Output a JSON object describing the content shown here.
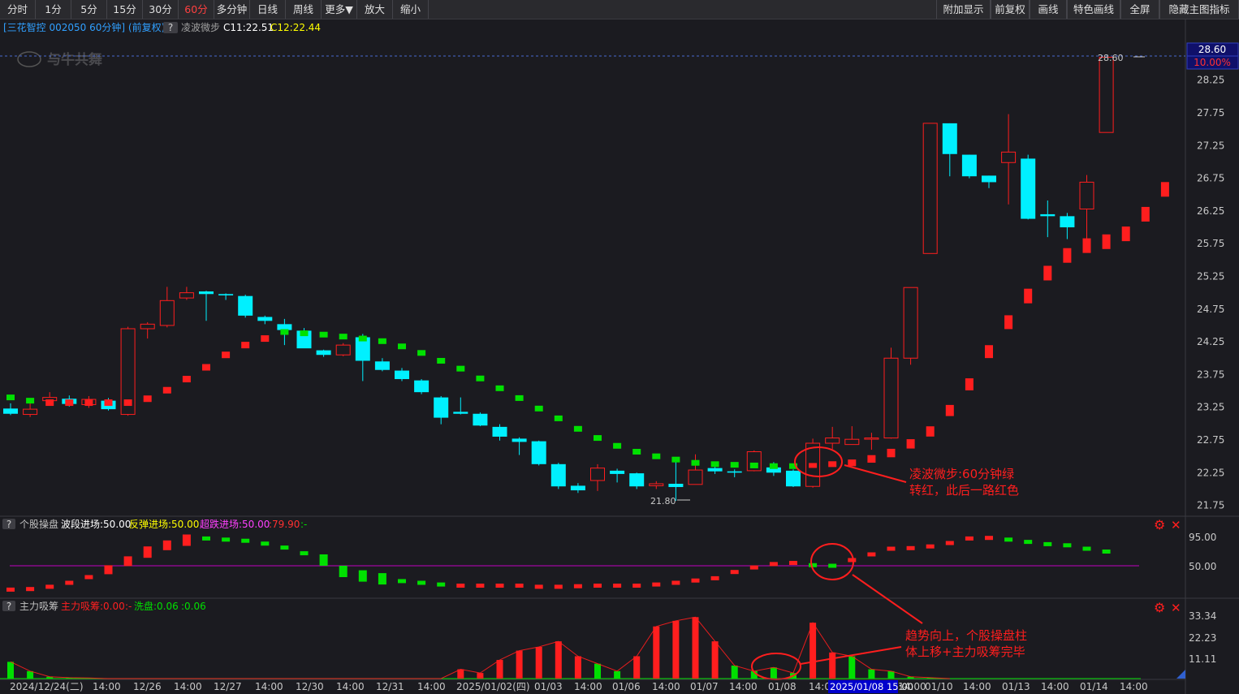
{
  "toolbar": {
    "left": [
      "分时",
      "1分",
      "5分",
      "15分",
      "30分",
      "60分",
      "多分钟",
      "日线",
      "周线",
      "更多▼",
      "放大",
      "缩小"
    ],
    "active": "60分",
    "right": [
      "附加显示",
      "前复权",
      "画线",
      "特色画线",
      "全屏",
      "隐藏主图指标"
    ]
  },
  "header": {
    "stock": "[三花智控 002050 60分钟] (前复权)",
    "q": "?",
    "indicator": "凌波微步",
    "c1": "C11:22.51",
    "c2": "C12:22.44"
  },
  "watermark": "与牛共舞",
  "price_axis": {
    "labels": [
      "28.25",
      "27.75",
      "27.25",
      "26.75",
      "26.25",
      "25.75",
      "25.25",
      "24.75",
      "24.25",
      "23.75",
      "23.25",
      "22.75",
      "22.25",
      "21.75"
    ],
    "high_price": "28.60",
    "high_pct": "10.00%",
    "high_label": "28.60",
    "low_label": "21.80"
  },
  "annotations": {
    "a1_line1": "凌波微步:60分钟绿",
    "a1_line2": "转红，此后一路红色",
    "a2_line1": "趋势向上，个股操盘柱",
    "a2_line2": "体上移+主力吸筹完毕"
  },
  "panel1": {
    "q": "?",
    "name": "个股操盘",
    "s1": "波段进场:50.00",
    "s2": "反弹进场:50.00",
    "s3": "超跌进场:50.00",
    "s4": ":79.90",
    "s5": ":-",
    "axis": [
      "95.00",
      "50.00"
    ]
  },
  "panel2": {
    "q": "?",
    "name": "主力吸筹",
    "s1": "主力吸筹:0.00",
    "s2": ":-",
    "s3": "洗盘:0.06",
    "s4": ":0.06",
    "axis": [
      "33.34",
      "22.23",
      "11.11"
    ]
  },
  "x_axis": [
    "2024/12/24(二)",
    "14:00",
    "12/26",
    "14:00",
    "12/27",
    "14:00",
    "12/30",
    "14:00",
    "12/31",
    "14:00",
    "2025/01/02(四)",
    "01/03",
    "14:00",
    "01/06",
    "14:00",
    "01/07",
    "14:00",
    "01/08",
    "14:00",
    "2025/01/08 15:00",
    "14:00",
    "01/10",
    "14:00",
    "01/13",
    "14:00",
    "01/14",
    "14:00"
  ],
  "colors": {
    "up": "#ff1e1e",
    "down": "#00f0ff",
    "green": "#00e000",
    "purple": "#c000c0",
    "yellow": "#e8e800",
    "cursor": "#0000cc"
  },
  "chart_data": {
    "type": "candlestick",
    "candles": [
      [
        23.23,
        23.15,
        23.31,
        23.13
      ],
      [
        23.14,
        23.22,
        23.31,
        23.1
      ],
      [
        23.35,
        23.4,
        23.48,
        23.32
      ],
      [
        23.38,
        23.3,
        23.43,
        23.26
      ],
      [
        23.29,
        23.37,
        23.42,
        23.24
      ],
      [
        23.35,
        23.22,
        23.39,
        23.2
      ],
      [
        23.14,
        24.45,
        24.48,
        23.12
      ],
      [
        24.45,
        24.52,
        24.55,
        24.3
      ],
      [
        24.5,
        24.88,
        25.09,
        24.47
      ],
      [
        24.92,
        25.0,
        25.09,
        24.89
      ],
      [
        25.02,
        24.98,
        25.03,
        24.57
      ],
      [
        24.98,
        24.96,
        24.99,
        24.89
      ],
      [
        24.95,
        24.65,
        24.97,
        24.62
      ],
      [
        24.63,
        24.57,
        24.65,
        24.52
      ],
      [
        24.52,
        24.43,
        24.6,
        24.2
      ],
      [
        24.42,
        24.15,
        24.46,
        24.16
      ],
      [
        24.12,
        24.05,
        24.13,
        24.02
      ],
      [
        24.05,
        24.2,
        24.23,
        24.03
      ],
      [
        24.32,
        23.96,
        24.37,
        23.65
      ],
      [
        23.95,
        23.82,
        24.0,
        23.8
      ],
      [
        23.81,
        23.68,
        23.85,
        23.65
      ],
      [
        23.66,
        23.48,
        23.68,
        23.45
      ],
      [
        23.4,
        23.09,
        23.42,
        22.99
      ],
      [
        23.18,
        23.15,
        23.4,
        23.14
      ],
      [
        23.15,
        22.97,
        23.17,
        22.96
      ],
      [
        22.95,
        22.8,
        22.99,
        22.74
      ],
      [
        22.77,
        22.72,
        22.79,
        22.52
      ],
      [
        22.73,
        22.38,
        22.74,
        22.36
      ],
      [
        22.38,
        22.04,
        22.4,
        22.0
      ],
      [
        22.05,
        21.98,
        22.09,
        21.94
      ],
      [
        22.13,
        22.32,
        22.38,
        21.97
      ],
      [
        22.28,
        22.23,
        22.31,
        22.1
      ],
      [
        22.24,
        22.04,
        22.25,
        22.0
      ],
      [
        22.05,
        22.08,
        22.12,
        22.0
      ],
      [
        22.08,
        22.03,
        22.45,
        21.82
      ],
      [
        22.07,
        22.29,
        22.53,
        22.08
      ],
      [
        22.32,
        22.27,
        22.34,
        22.23
      ],
      [
        22.27,
        22.25,
        22.3,
        22.18
      ],
      [
        22.28,
        22.57,
        22.59,
        22.27
      ],
      [
        22.33,
        22.25,
        22.41,
        22.2
      ],
      [
        22.28,
        22.04,
        22.3,
        22.03
      ],
      [
        22.04,
        22.7,
        22.77,
        22.02
      ],
      [
        22.7,
        22.78,
        22.95,
        22.61
      ],
      [
        22.68,
        22.76,
        22.96,
        22.68
      ],
      [
        22.78,
        22.78,
        22.86,
        22.6
      ],
      [
        22.78,
        24.0,
        24.16,
        22.77
      ],
      [
        24.0,
        25.08,
        25.08,
        23.9
      ],
      [
        25.6,
        27.59,
        27.59,
        25.6
      ],
      [
        27.59,
        27.12,
        27.59,
        26.78
      ],
      [
        27.11,
        26.78,
        27.11,
        26.75
      ],
      [
        26.79,
        26.69,
        26.79,
        26.6
      ],
      [
        26.99,
        27.15,
        27.73,
        26.35
      ],
      [
        27.05,
        26.13,
        27.11,
        26.12
      ],
      [
        26.2,
        26.17,
        26.41,
        25.85
      ],
      [
        26.17,
        26.0,
        26.22,
        25.82
      ],
      [
        26.28,
        26.69,
        26.8,
        25.81
      ],
      [
        27.45,
        28.6,
        28.6,
        27.45
      ]
    ],
    "lingbo": [
      [
        23.4,
        "g"
      ],
      [
        23.35,
        "g"
      ],
      [
        23.32,
        "r"
      ],
      [
        23.32,
        "r"
      ],
      [
        23.32,
        "r"
      ],
      [
        23.32,
        "r"
      ],
      [
        23.32,
        "r"
      ],
      [
        23.38,
        "r"
      ],
      [
        23.51,
        "r"
      ],
      [
        23.68,
        "r"
      ],
      [
        23.86,
        "r"
      ],
      [
        24.05,
        "r"
      ],
      [
        24.2,
        "r"
      ],
      [
        24.3,
        "r"
      ],
      [
        24.4,
        "g"
      ],
      [
        24.38,
        "g"
      ],
      [
        24.36,
        "g"
      ],
      [
        24.33,
        "g"
      ],
      [
        24.3,
        "g"
      ],
      [
        24.26,
        "g"
      ],
      [
        24.18,
        "g"
      ],
      [
        24.08,
        "g"
      ],
      [
        23.96,
        "g"
      ],
      [
        23.84,
        "g"
      ],
      [
        23.69,
        "g"
      ],
      [
        23.54,
        "g"
      ],
      [
        23.39,
        "g"
      ],
      [
        23.23,
        "g"
      ],
      [
        23.08,
        "g"
      ],
      [
        22.92,
        "g"
      ],
      [
        22.78,
        "g"
      ],
      [
        22.66,
        "g"
      ],
      [
        22.57,
        "g"
      ],
      [
        22.5,
        "g"
      ],
      [
        22.45,
        "g"
      ],
      [
        22.4,
        "g"
      ],
      [
        22.38,
        "g"
      ],
      [
        22.37,
        "g"
      ],
      [
        22.36,
        "g"
      ],
      [
        22.35,
        "g"
      ],
      [
        22.35,
        "g"
      ],
      [
        22.36,
        "r"
      ],
      [
        22.38,
        "r"
      ],
      [
        22.4,
        "r"
      ],
      [
        22.46,
        "r"
      ],
      [
        22.55,
        "r"
      ],
      [
        22.69,
        "r"
      ],
      [
        22.88,
        "r"
      ],
      [
        23.2,
        "r"
      ],
      [
        23.6,
        "r"
      ],
      [
        24.1,
        "r"
      ],
      [
        24.55,
        "r"
      ],
      [
        24.95,
        "r"
      ],
      [
        25.3,
        "r"
      ],
      [
        25.57,
        "r"
      ],
      [
        25.72,
        "r"
      ],
      [
        25.78,
        "r"
      ],
      [
        25.9,
        "r"
      ],
      [
        26.2,
        "r"
      ],
      [
        26.58,
        "r"
      ]
    ],
    "caopan": [
      [
        8,
        "r"
      ],
      [
        9,
        "r"
      ],
      [
        13,
        "r"
      ],
      [
        20,
        "r"
      ],
      [
        30,
        "r"
      ],
      [
        43,
        "r"
      ],
      [
        58,
        "r"
      ],
      [
        74,
        "r"
      ],
      [
        86,
        "r"
      ],
      [
        95,
        "r"
      ],
      [
        98,
        "g"
      ],
      [
        96,
        "g"
      ],
      [
        94,
        "g"
      ],
      [
        89,
        "g"
      ],
      [
        82,
        "g"
      ],
      [
        72,
        "g"
      ],
      [
        60,
        "g"
      ],
      [
        40,
        "g"
      ],
      [
        32,
        "g"
      ],
      [
        27,
        "g"
      ],
      [
        23,
        "g"
      ],
      [
        20,
        "g"
      ],
      [
        17,
        "g"
      ],
      [
        15,
        "r"
      ],
      [
        15,
        "r"
      ],
      [
        15,
        "r"
      ],
      [
        15,
        "r"
      ],
      [
        13,
        "r"
      ],
      [
        13,
        "r"
      ],
      [
        14,
        "r"
      ],
      [
        15,
        "r"
      ],
      [
        15,
        "r"
      ],
      [
        15,
        "r"
      ],
      [
        17,
        "r"
      ],
      [
        20,
        "r"
      ],
      [
        24,
        "r"
      ],
      [
        28,
        "r"
      ],
      [
        39,
        "r"
      ],
      [
        47,
        "r"
      ],
      [
        53,
        "r"
      ],
      [
        55,
        "r"
      ],
      [
        51,
        "g"
      ],
      [
        50,
        "g"
      ],
      [
        60,
        "r"
      ],
      [
        70,
        "r"
      ],
      [
        80,
        "r"
      ],
      [
        81,
        "r"
      ],
      [
        84,
        "r"
      ],
      [
        90,
        "r"
      ],
      [
        98,
        "r"
      ],
      [
        99,
        "r"
      ],
      [
        96,
        "g"
      ],
      [
        92,
        "g"
      ],
      [
        88,
        "g"
      ],
      [
        86,
        "g"
      ],
      [
        80,
        "g"
      ],
      [
        75,
        "g"
      ],
      [
        74,
        "r"
      ],
      [
        82,
        "r"
      ],
      [
        95,
        "r"
      ],
      [
        99,
        "r"
      ]
    ],
    "xichou": [
      [
        9,
        "g"
      ],
      [
        4,
        "g"
      ],
      [
        1,
        "g"
      ],
      [
        0.5,
        "g"
      ],
      [
        0.3,
        "g"
      ],
      [
        0,
        "n"
      ],
      [
        0,
        "n"
      ],
      [
        0,
        "n"
      ],
      [
        0,
        "n"
      ],
      [
        0,
        "n"
      ],
      [
        0,
        "n"
      ],
      [
        0,
        "n"
      ],
      [
        0,
        "n"
      ],
      [
        0,
        "n"
      ],
      [
        0,
        "n"
      ],
      [
        0,
        "n"
      ],
      [
        0,
        "n"
      ],
      [
        0,
        "n"
      ],
      [
        0,
        "n"
      ],
      [
        0,
        "n"
      ],
      [
        0,
        "n"
      ],
      [
        0,
        "n"
      ],
      [
        0,
        "n"
      ],
      [
        5,
        "r"
      ],
      [
        3,
        "r"
      ],
      [
        10,
        "r"
      ],
      [
        15,
        "r"
      ],
      [
        17,
        "r"
      ],
      [
        20,
        "r"
      ],
      [
        12,
        "r"
      ],
      [
        8,
        "g"
      ],
      [
        4,
        "g"
      ],
      [
        12,
        "r"
      ],
      [
        28,
        "r"
      ],
      [
        31,
        "r"
      ],
      [
        33,
        "r"
      ],
      [
        20,
        "r"
      ],
      [
        7,
        "g"
      ],
      [
        4,
        "g"
      ],
      [
        6,
        "g"
      ],
      [
        3,
        "g"
      ],
      [
        30,
        "r"
      ],
      [
        14,
        "r"
      ],
      [
        12,
        "g"
      ],
      [
        5,
        "g"
      ],
      [
        4,
        "g"
      ],
      [
        1,
        "g"
      ],
      [
        0.5,
        "g"
      ],
      [
        0,
        "n"
      ]
    ]
  }
}
